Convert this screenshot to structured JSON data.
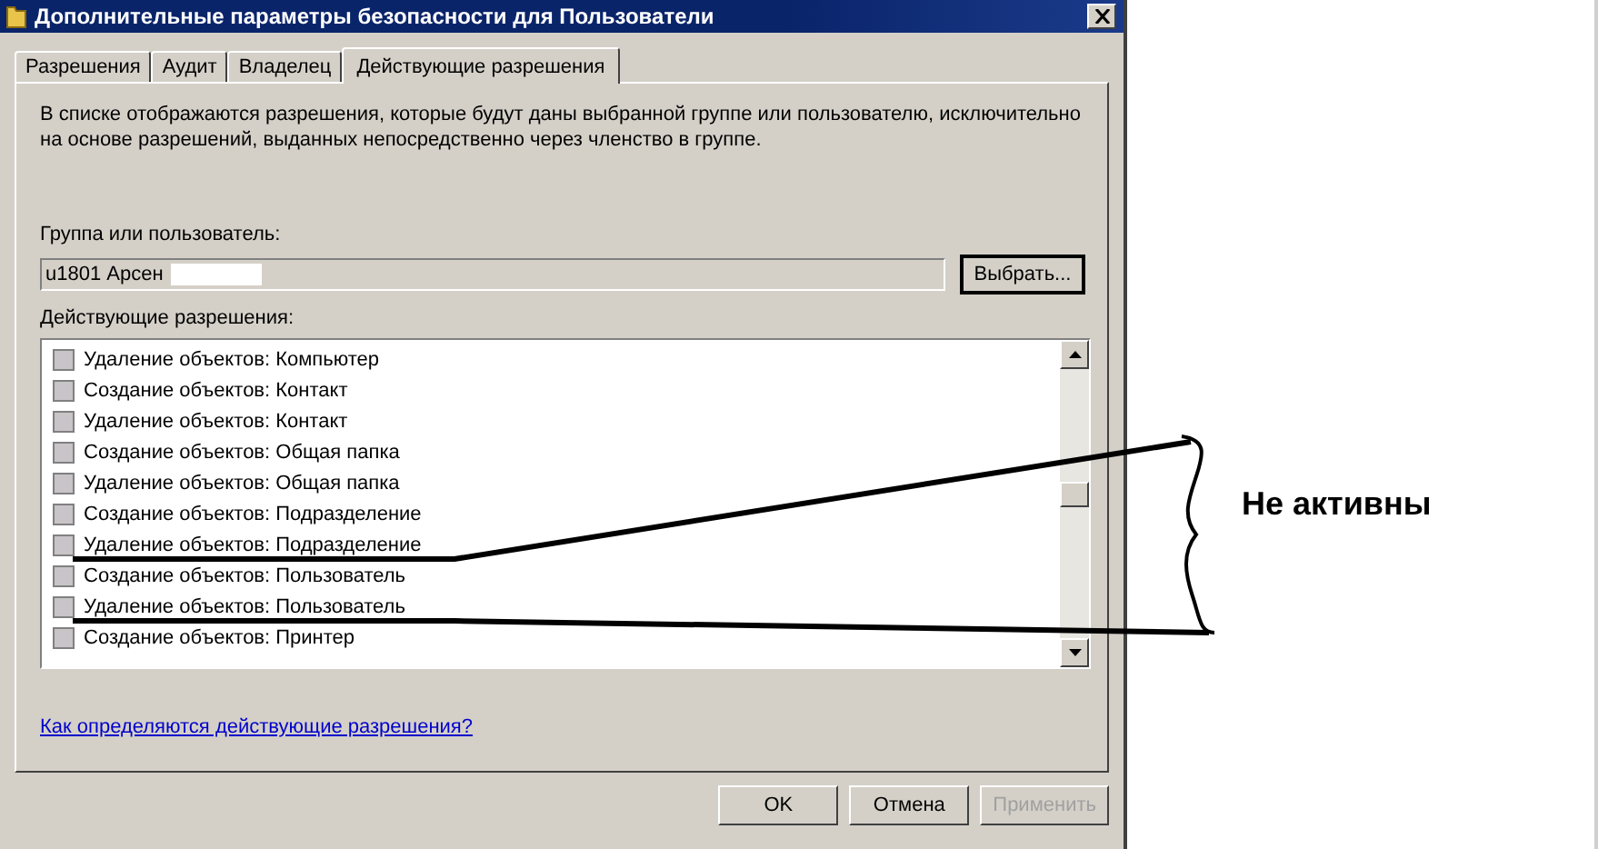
{
  "window": {
    "title": "Дополнительные параметры безопасности для Пользователи"
  },
  "tabs": [
    {
      "label": "Разрешения",
      "selected": false
    },
    {
      "label": "Аудит",
      "selected": false
    },
    {
      "label": "Владелец",
      "selected": false
    },
    {
      "label": "Действующие разрешения",
      "selected": true
    }
  ],
  "description": "В списке отображаются разрешения, которые будут даны выбранной группе или пользователю, исключительно на основе разрешений, выданных непосредственно через членство в группе.",
  "group_field": {
    "label": "Группа или пользователь:",
    "value": "u1801 Арсен"
  },
  "select_button": "Выбрать...",
  "permissions": {
    "label": "Действующие разрешения:",
    "items": [
      {
        "label": "Удаление объектов: Компьютер",
        "checked": false
      },
      {
        "label": "Создание объектов: Контакт",
        "checked": false
      },
      {
        "label": "Удаление объектов: Контакт",
        "checked": false
      },
      {
        "label": "Создание объектов: Общая папка",
        "checked": false
      },
      {
        "label": "Удаление объектов: Общая папка",
        "checked": false
      },
      {
        "label": "Создание объектов: Подразделение",
        "checked": false
      },
      {
        "label": "Удаление объектов: Подразделение",
        "checked": false
      },
      {
        "label": "Создание объектов: Пользователь",
        "checked": false
      },
      {
        "label": "Удаление объектов: Пользователь",
        "checked": false
      },
      {
        "label": "Создание объектов: Принтер",
        "checked": false
      }
    ]
  },
  "help_link": "Как определяются действующие разрешения?",
  "buttons": [
    {
      "label": "OK",
      "disabled": false
    },
    {
      "label": "Отмена",
      "disabled": false
    },
    {
      "label": "Применить",
      "disabled": true
    }
  ],
  "annotation": "Не активны"
}
